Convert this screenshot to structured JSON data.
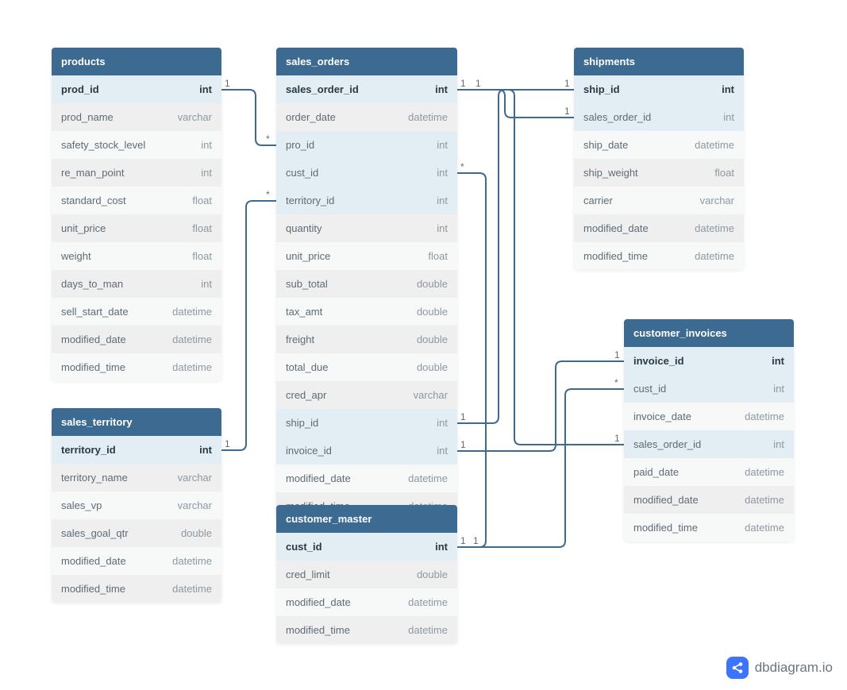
{
  "brand": "dbdiagram.io",
  "tables": {
    "products": {
      "title": "products",
      "cols": [
        {
          "name": "prod_id",
          "type": "int",
          "pk": true
        },
        {
          "name": "prod_name",
          "type": "varchar"
        },
        {
          "name": "safety_stock_level",
          "type": "int"
        },
        {
          "name": "re_man_point",
          "type": "int"
        },
        {
          "name": "standard_cost",
          "type": "float"
        },
        {
          "name": "unit_price",
          "type": "float"
        },
        {
          "name": "weight",
          "type": "float"
        },
        {
          "name": "days_to_man",
          "type": "int"
        },
        {
          "name": "sell_start_date",
          "type": "datetime"
        },
        {
          "name": "modified_date",
          "type": "datetime"
        },
        {
          "name": "modified_time",
          "type": "datetime"
        }
      ]
    },
    "sales_territory": {
      "title": "sales_territory",
      "cols": [
        {
          "name": "territory_id",
          "type": "int",
          "pk": true
        },
        {
          "name": "territory_name",
          "type": "varchar"
        },
        {
          "name": "sales_vp",
          "type": "varchar"
        },
        {
          "name": "sales_goal_qtr",
          "type": "double"
        },
        {
          "name": "modified_date",
          "type": "datetime"
        },
        {
          "name": "modified_time",
          "type": "datetime"
        }
      ]
    },
    "sales_orders": {
      "title": "sales_orders",
      "cols": [
        {
          "name": "sales_order_id",
          "type": "int",
          "pk": true
        },
        {
          "name": "order_date",
          "type": "datetime"
        },
        {
          "name": "pro_id",
          "type": "int",
          "fk": true
        },
        {
          "name": "cust_id",
          "type": "int",
          "fk": true
        },
        {
          "name": "territory_id",
          "type": "int",
          "fk": true
        },
        {
          "name": "quantity",
          "type": "int"
        },
        {
          "name": "unit_price",
          "type": "float"
        },
        {
          "name": "sub_total",
          "type": "double"
        },
        {
          "name": "tax_amt",
          "type": "double"
        },
        {
          "name": "freight",
          "type": "double"
        },
        {
          "name": "total_due",
          "type": "double"
        },
        {
          "name": "cred_apr",
          "type": "varchar"
        },
        {
          "name": "ship_id",
          "type": "int",
          "fk": true
        },
        {
          "name": "invoice_id",
          "type": "int",
          "fk": true
        },
        {
          "name": "modified_date",
          "type": "datetime"
        },
        {
          "name": "modified_time",
          "type": "datetime"
        }
      ]
    },
    "customer_master": {
      "title": "customer_master",
      "cols": [
        {
          "name": "cust_id",
          "type": "int",
          "pk": true
        },
        {
          "name": "modified_date",
          "type": "datetime"
        },
        {
          "name": "modified_time",
          "type": "datetime"
        }
      ],
      "extra_first": {
        "name": "cred_limit",
        "type": "double"
      }
    },
    "shipments": {
      "title": "shipments",
      "cols": [
        {
          "name": "ship_id",
          "type": "int",
          "pk": true
        },
        {
          "name": "sales_order_id",
          "type": "int",
          "fk": true
        },
        {
          "name": "ship_date",
          "type": "datetime"
        },
        {
          "name": "ship_weight",
          "type": "float"
        },
        {
          "name": "carrier",
          "type": "varchar"
        },
        {
          "name": "modified_date",
          "type": "datetime"
        },
        {
          "name": "modified_time",
          "type": "datetime"
        }
      ]
    },
    "customer_invoices": {
      "title": "customer_invoices",
      "cols": [
        {
          "name": "invoice_id",
          "type": "int",
          "pk": true
        },
        {
          "name": "cust_id",
          "type": "int",
          "fk": true
        },
        {
          "name": "invoice_date",
          "type": "datetime"
        },
        {
          "name": "sales_order_id",
          "type": "int",
          "fk": true
        },
        {
          "name": "paid_date",
          "type": "datetime"
        },
        {
          "name": "modified_date",
          "type": "datetime"
        },
        {
          "name": "modified_time",
          "type": "datetime"
        }
      ]
    }
  },
  "cardinality": {
    "one": "1",
    "many": "*"
  },
  "relationships": [
    {
      "from": "products.prod_id",
      "to": "sales_orders.pro_id",
      "from_card": "1",
      "to_card": "*"
    },
    {
      "from": "sales_territory.territory_id",
      "to": "sales_orders.territory_id",
      "from_card": "1",
      "to_card": "*"
    },
    {
      "from": "sales_orders.sales_order_id",
      "to": "shipments.sales_order_id",
      "from_card": "1",
      "to_card": "1"
    },
    {
      "from": "sales_orders.sales_order_id",
      "to": "customer_invoices.sales_order_id",
      "from_card": "1",
      "to_card": "1"
    },
    {
      "from": "sales_orders.cust_id",
      "to": "customer_master.cust_id",
      "from_card": "*",
      "to_card": "1"
    },
    {
      "from": "sales_orders.ship_id",
      "to": "shipments.ship_id",
      "from_card": "1",
      "to_card": "1"
    },
    {
      "from": "sales_orders.invoice_id",
      "to": "customer_invoices.invoice_id",
      "from_card": "1",
      "to_card": "1"
    },
    {
      "from": "customer_master.cust_id",
      "to": "customer_invoices.cust_id",
      "from_card": "1",
      "to_card": "*"
    }
  ],
  "chart_data": {
    "type": "erd",
    "entities": [
      "products",
      "sales_territory",
      "sales_orders",
      "customer_master",
      "shipments",
      "customer_invoices"
    ],
    "relationships": [
      {
        "left": "products",
        "right": "sales_orders",
        "cardinality": "1:*"
      },
      {
        "left": "sales_territory",
        "right": "sales_orders",
        "cardinality": "1:*"
      },
      {
        "left": "sales_orders",
        "right": "shipments",
        "cardinality": "1:1"
      },
      {
        "left": "sales_orders",
        "right": "customer_invoices",
        "cardinality": "1:1"
      },
      {
        "left": "customer_master",
        "right": "sales_orders",
        "cardinality": "1:*"
      },
      {
        "left": "customer_master",
        "right": "customer_invoices",
        "cardinality": "1:*"
      }
    ]
  }
}
